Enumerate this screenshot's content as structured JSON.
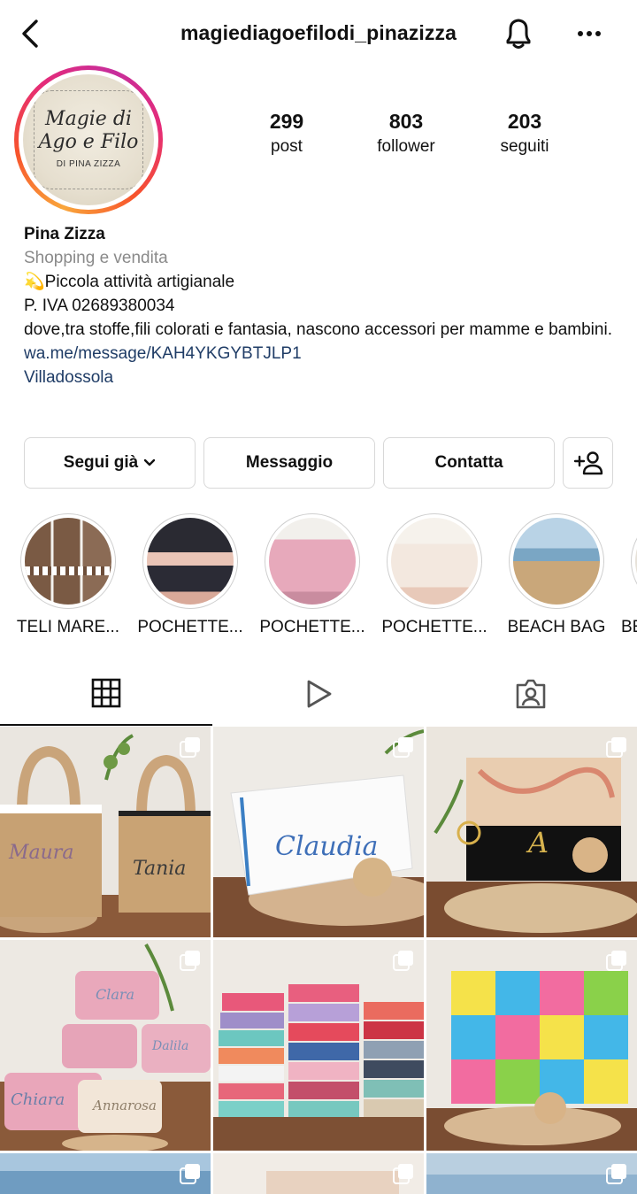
{
  "header": {
    "username": "magiediagoefilodi_pinazizza",
    "back_icon": "chevron-left-icon",
    "bell_icon": "bell-icon",
    "more_icon": "more-horizontal-icon"
  },
  "avatar": {
    "logo_line1": "Magie di",
    "logo_line2": "Ago e Filo",
    "logo_line3": "DI PINA ZIZZA",
    "ring_colors": [
      "#f9a63b",
      "#f7532c",
      "#e52b78",
      "#c72e9c"
    ]
  },
  "stats": [
    {
      "value": "299",
      "label": "post"
    },
    {
      "value": "803",
      "label": "follower"
    },
    {
      "value": "203",
      "label": "seguiti"
    }
  ],
  "bio": {
    "name": "Pina Zizza",
    "category": "Shopping e vendita",
    "line1": "💫Piccola attività artigianale",
    "line2": "P. IVA 02689380034",
    "line3": "dove,tra stoffe,fili colorati e fantasia, nascono accessori per mamme e bambini.",
    "link": "wa.me/message/KAH4YKGYBTJLP1",
    "location": "Villadossola"
  },
  "actions": {
    "follow_label": "Segui già",
    "message_label": "Messaggio",
    "contact_label": "Contatta",
    "add_person_icon": "add-person-icon"
  },
  "highlights": [
    {
      "label": "TELI MARE..."
    },
    {
      "label": "POCHETTE..."
    },
    {
      "label": "POCHETTE..."
    },
    {
      "label": "POCHETTE..."
    },
    {
      "label": "BEACH BAG"
    },
    {
      "label": "BE"
    }
  ],
  "tabs": [
    {
      "name": "grid",
      "icon": "grid-icon"
    },
    {
      "name": "reels",
      "icon": "play-icon"
    },
    {
      "name": "tagged",
      "icon": "tagged-person-icon"
    }
  ],
  "posts": [
    {
      "caption1": "Maura",
      "caption2": "Tania"
    },
    {
      "caption1": "Claudia"
    },
    {
      "caption1": "A"
    },
    {
      "caption1": "Clara",
      "caption2": "Chiara",
      "caption3": "Annarosa",
      "caption4": "Dalila"
    },
    {},
    {}
  ],
  "colors": {
    "link": "#1f3c66",
    "muted": "#8a8a8a",
    "border": "#d8d8d8"
  }
}
